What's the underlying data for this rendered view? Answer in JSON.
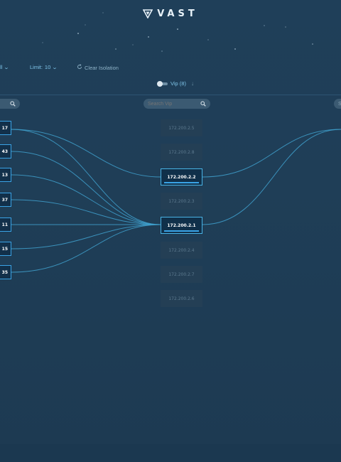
{
  "brand": {
    "name": "VAST"
  },
  "controls": {
    "all_label": "ll",
    "limit_label": "Limit:",
    "limit_value": "10",
    "clear_label": "Clear Isolation"
  },
  "vip_toggle": {
    "label": "Vip (8)"
  },
  "search": {
    "vip_placeholder": "Search Vip",
    "right_placeholder": "S"
  },
  "left_nodes": [
    "17",
    "43",
    "13",
    "37",
    "11",
    "15",
    "35"
  ],
  "vip_nodes": [
    {
      "ip": "172.200.2.5",
      "active": false
    },
    {
      "ip": "172.200.2.8",
      "active": false
    },
    {
      "ip": "172.200.2.2",
      "active": true
    },
    {
      "ip": "172.200.2.3",
      "active": false
    },
    {
      "ip": "172.200.2.1",
      "active": true
    },
    {
      "ip": "172.200.2.4",
      "active": false
    },
    {
      "ip": "172.200.2.7",
      "active": false
    },
    {
      "ip": "172.200.2.6",
      "active": false
    }
  ],
  "colors": {
    "link": "#3fa0cc",
    "accent": "#3aa3e6",
    "background": "#1f3f59"
  }
}
